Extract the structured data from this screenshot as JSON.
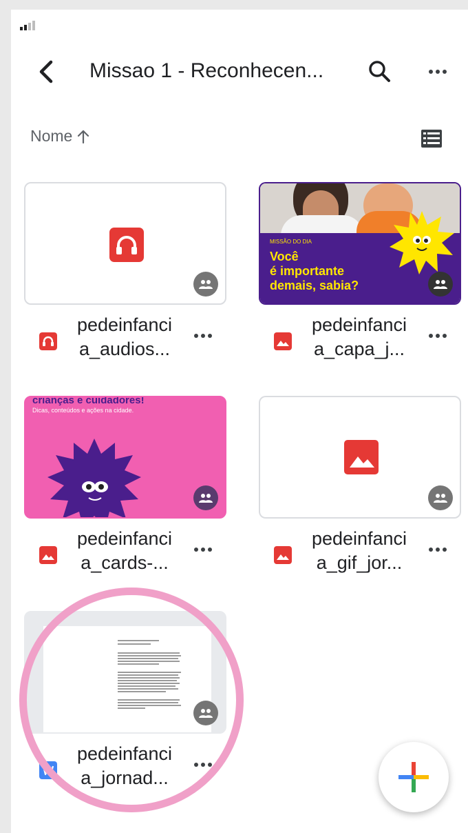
{
  "toolbar": {
    "title": "Missao 1 - Reconhecen..."
  },
  "sort": {
    "label": "Nome",
    "direction_icon": "arrow-up-icon"
  },
  "files": [
    {
      "name_line1": "pedeinfanci",
      "name_line2": "a_audios...",
      "type": "audio",
      "icon": "headphones-icon",
      "icon_color": "#e53935"
    },
    {
      "name_line1": "pedeinfanci",
      "name_line2": "a_capa_j...",
      "type": "image",
      "icon": "image-icon",
      "icon_color": "#e53935",
      "thumb": {
        "kicker": "MISSÃO DO DIA",
        "line1": "Você",
        "line2": "é importante",
        "line3": "demais, sabia?"
      }
    },
    {
      "name_line1": "pedeinfanci",
      "name_line2": "a_cards-...",
      "type": "image",
      "icon": "image-icon",
      "icon_color": "#e53935",
      "thumb": {
        "headline": "crianças e cuidadores!",
        "sub": "Dicas, conteúdos e ações na cidade."
      }
    },
    {
      "name_line1": "pedeinfanci",
      "name_line2": "a_gif_jor...",
      "type": "image",
      "icon": "image-icon",
      "icon_color": "#e53935"
    },
    {
      "name_line1": "pedeinfanci",
      "name_line2": "a_jornad...",
      "type": "document",
      "icon": "word-doc-icon",
      "icon_color": "#4285f4"
    }
  ],
  "colors": {
    "thumb_purple": "#4a1e8c",
    "thumb_pink": "#f15fb1",
    "thumb_yellow": "#ffe600",
    "highlight_circle": "#f0a0c8"
  }
}
